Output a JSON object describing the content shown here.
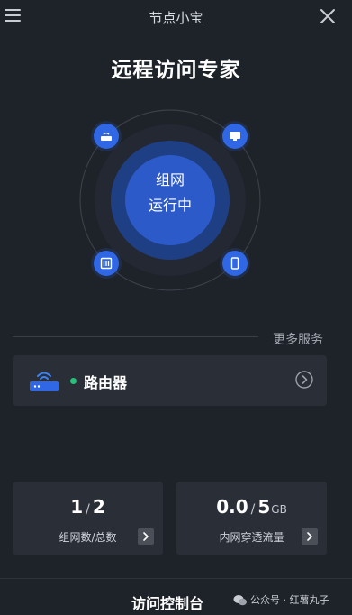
{
  "header": {
    "title": "节点小宝",
    "menu_icon": "hamburger-menu-icon",
    "close_icon": "close-icon"
  },
  "hero": {
    "title": "远程访问专家",
    "center_line1": "组网",
    "center_line2": "运行中",
    "nodes": [
      "router-icon",
      "desktop-icon",
      "server-icon",
      "phone-icon"
    ]
  },
  "services": {
    "more_label": "更多服务"
  },
  "router": {
    "label": "路由器",
    "status_color": "#27c07a"
  },
  "stats": {
    "network": {
      "current": "1",
      "separator": "/",
      "total": "2",
      "label": "组网数/总数"
    },
    "traffic": {
      "current": "0.0",
      "separator": "/",
      "total": "5",
      "unit": "GB",
      "label": "内网穿透流量"
    }
  },
  "footer": {
    "console_label": "访问控制台",
    "watermark": "公众号 · 红薯丸子"
  },
  "colors": {
    "background": "#1e2229",
    "card": "#2a2e36",
    "accent": "#2f67e4",
    "status_online": "#27c07a"
  }
}
